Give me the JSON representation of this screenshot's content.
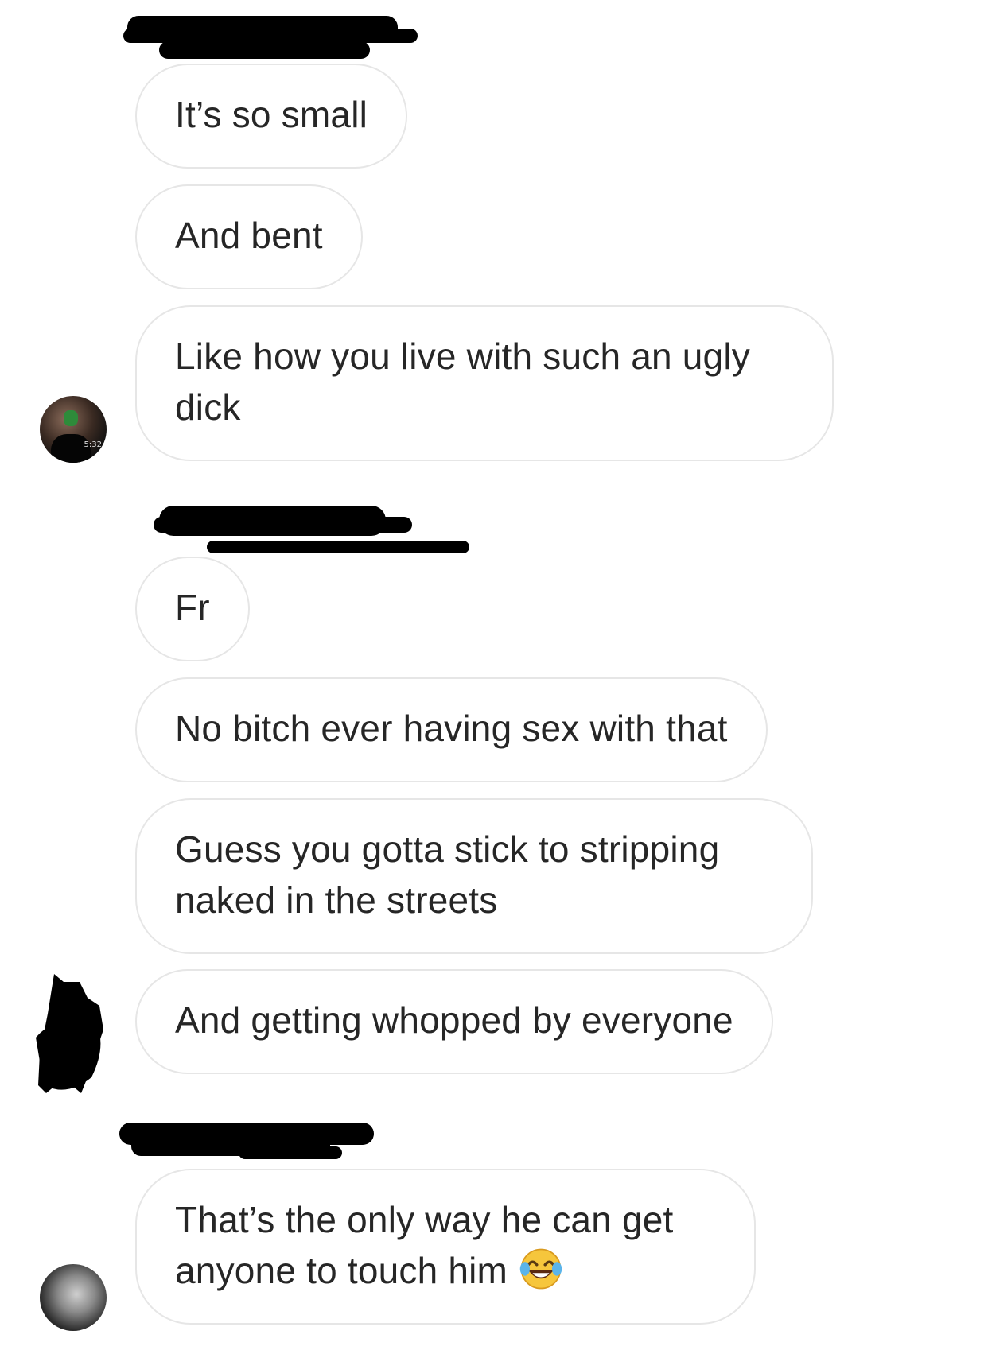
{
  "messages": [
    {
      "text": "It’s so small"
    },
    {
      "text": "And bent"
    },
    {
      "text": "Like how you live with such an ugly",
      "text2": "dick"
    },
    {
      "text": "Fr"
    },
    {
      "text": "No bitch ever having sex with that"
    },
    {
      "text": "Guess you gotta stick to stripping",
      "text2": "naked in the streets"
    },
    {
      "text": "And getting whopped by everyone"
    },
    {
      "text": "That’s the only way he can get",
      "text2": "anyone to touch him"
    }
  ],
  "avatars": {
    "first_timestamp": "5:32"
  },
  "icons": {
    "emoji": "face-with-tears-of-joy-icon"
  },
  "colors": {
    "bubble_border": "#e6e6e6",
    "text": "#262626",
    "redaction": "#000000"
  }
}
